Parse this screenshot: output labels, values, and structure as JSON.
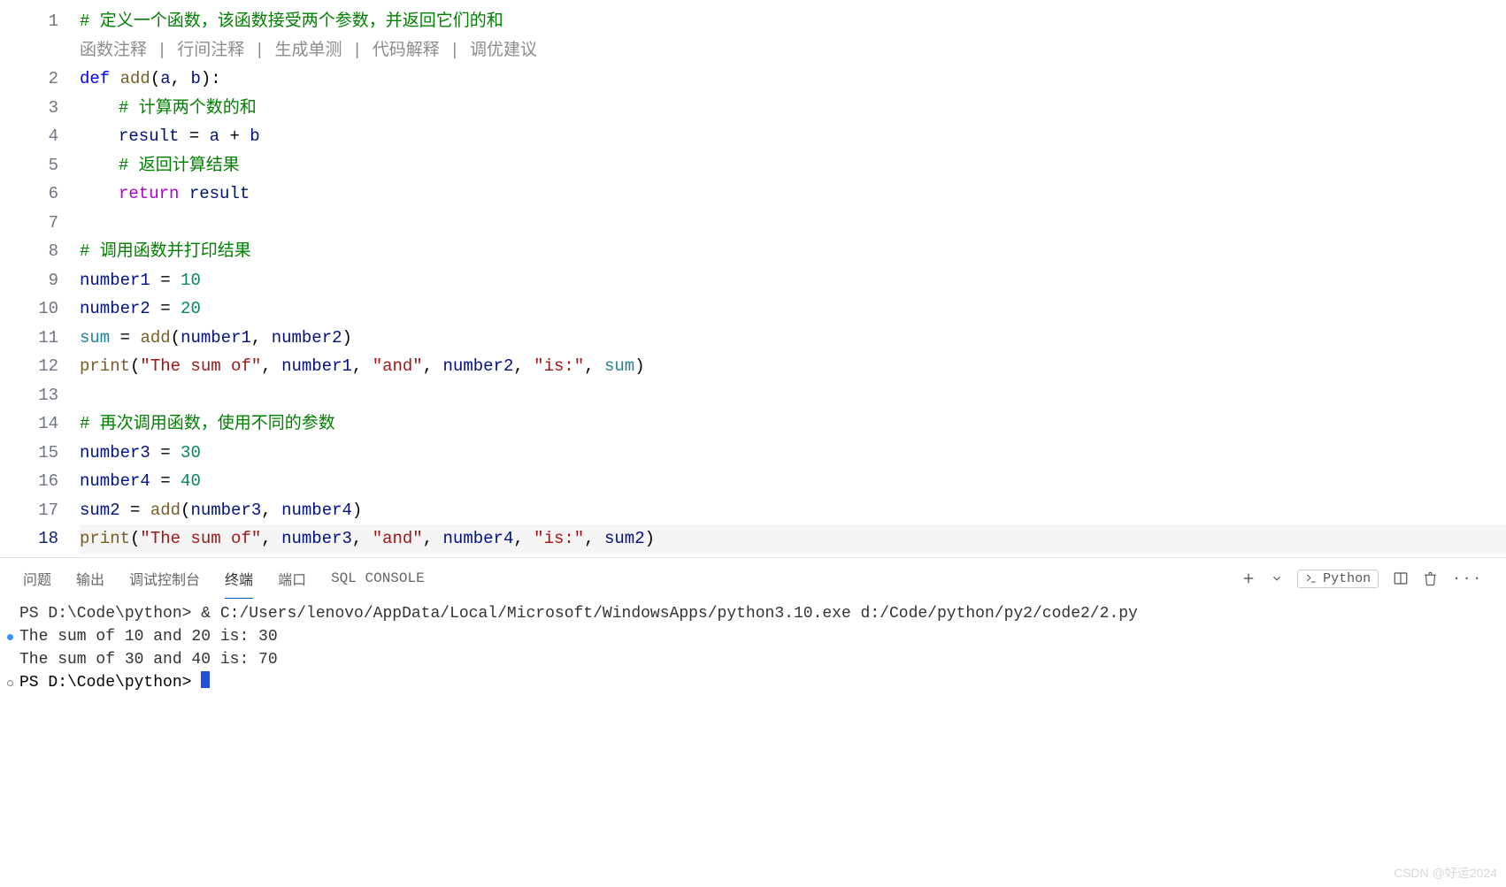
{
  "editor": {
    "hints": {
      "a": "函数注释",
      "b": "行间注释",
      "c": "生成单测",
      "d": "代码解释",
      "e": "调优建议",
      "sep": " | "
    },
    "lines": {
      "l1_comment": "# 定义一个函数，该函数接受两个参数，并返回它们的和",
      "l2_def": "def",
      "l2_name": "add",
      "l2_p1": "a",
      "l2_p2": "b",
      "l3_comment": "# 计算两个数的和",
      "l4_var": "result",
      "l4_a": "a",
      "l4_b": "b",
      "l5_comment": "# 返回计算结果",
      "l6_return": "return",
      "l6_result": "result",
      "l8_comment": "# 调用函数并打印结果",
      "l9_var": "number1",
      "l9_val": "10",
      "l10_var": "number2",
      "l10_val": "20",
      "l11_var": "sum",
      "l11_fn": "add",
      "l11_a1": "number1",
      "l11_a2": "number2",
      "l12_fn": "print",
      "l12_s1": "\"The sum of\"",
      "l12_a1": "number1",
      "l12_s2": "\"and\"",
      "l12_a2": "number2",
      "l12_s3": "\"is:\"",
      "l12_a3": "sum",
      "l14_comment": "# 再次调用函数，使用不同的参数",
      "l15_var": "number3",
      "l15_val": "30",
      "l16_var": "number4",
      "l16_val": "40",
      "l17_var": "sum2",
      "l17_fn": "add",
      "l17_a1": "number3",
      "l17_a2": "number4",
      "l18_fn": "print",
      "l18_s1": "\"The sum of\"",
      "l18_a1": "number3",
      "l18_s2": "\"and\"",
      "l18_a2": "number4",
      "l18_s3": "\"is:\"",
      "l18_a3": "sum2"
    },
    "line_numbers": [
      "1",
      "2",
      "3",
      "4",
      "5",
      "6",
      "7",
      "8",
      "9",
      "10",
      "11",
      "12",
      "13",
      "14",
      "15",
      "16",
      "17",
      "18"
    ],
    "active_line_index": 18
  },
  "panel": {
    "tabs": {
      "problems": "问题",
      "output": "输出",
      "debug": "调试控制台",
      "terminal": "终端",
      "ports": "端口",
      "sql": "SQL CONSOLE"
    },
    "shell_label": "Python"
  },
  "terminal": {
    "line1": "PS D:\\Code\\python> & C:/Users/lenovo/AppData/Local/Microsoft/WindowsApps/python3.10.exe d:/Code/python/py2/code2/2.py",
    "line2": "The sum of 10 and 20 is: 30",
    "line3": "The sum of 30 and 40 is: 70",
    "line4": "PS D:\\Code\\python> "
  },
  "watermark": "CSDN @好运2024"
}
